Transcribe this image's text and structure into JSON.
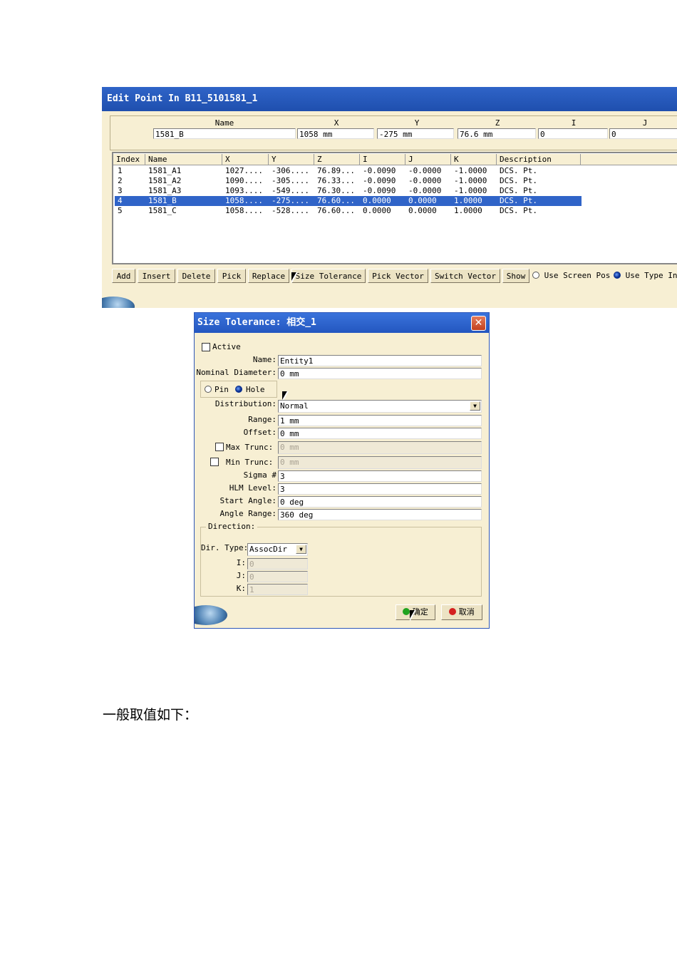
{
  "edit_point": {
    "title": "Edit Point In B11_5101581_1",
    "header_labels": [
      "Name",
      "X",
      "Y",
      "Z",
      "I",
      "J"
    ],
    "header_values": [
      "1581_B",
      "1058 mm",
      "-275 mm",
      "76.6 mm",
      "0",
      "0"
    ],
    "columns": [
      "Index",
      "Name",
      "X",
      "Y",
      "Z",
      "I",
      "J",
      "K",
      "Description"
    ],
    "rows": [
      [
        "1",
        "1581_A1",
        "1027....",
        "-306....",
        "76.89...",
        "-0.0090",
        "-0.0000",
        "-1.0000",
        "DCS. Pt."
      ],
      [
        "2",
        "1581_A2",
        "1090....",
        "-305....",
        "76.33...",
        "-0.0090",
        "-0.0000",
        "-1.0000",
        "DCS. Pt."
      ],
      [
        "3",
        "1581_A3",
        "1093....",
        "-549....",
        "76.30...",
        "-0.0090",
        "-0.0000",
        "-1.0000",
        "DCS. Pt."
      ],
      [
        "4",
        "1581_B",
        "1058....",
        "-275....",
        "76.60...",
        "0.0000",
        "0.0000",
        "1.0000",
        "DCS. Pt."
      ],
      [
        "5",
        "1581_C",
        "1058....",
        "-528....",
        "76.60...",
        "0.0000",
        "0.0000",
        "1.0000",
        "DCS. Pt."
      ]
    ],
    "selected_row_index": 3,
    "buttons": [
      "Add",
      "Insert",
      "Delete",
      "Pick",
      "Replace",
      "Size Tolerance",
      "Pick Vector",
      "Switch Vector",
      "Show"
    ],
    "radio_screen_pos": "Use Screen Pos",
    "radio_type_in": "Use Type In",
    "radio_selected": "Use Type In"
  },
  "size_tolerance": {
    "title": "Size Tolerance: 相交_1",
    "close": "✕",
    "active_label": "Active",
    "active_checked": false,
    "name_label": "Name:",
    "name_value": "Entity1",
    "nominal_label": "Nominal Diameter:",
    "nominal_value": "0 mm",
    "pin_label": "Pin",
    "hole_label": "Hole",
    "pin_hole_selected": "Hole",
    "distribution_label": "Distribution:",
    "distribution_value": "Normal",
    "range_label": "Range:",
    "range_value": "1 mm",
    "offset_label": "Offset:",
    "offset_value": "0 mm",
    "max_trunc_label": "Max Trunc:",
    "max_trunc_value": "0 mm",
    "min_trunc_label": "Min Trunc:",
    "min_trunc_value": "0 mm",
    "sigma_label": "Sigma #",
    "sigma_value": "3",
    "hlm_label": "HLM Level:",
    "hlm_value": "3",
    "start_angle_label": "Start Angle:",
    "start_angle_value": "0 deg",
    "angle_range_label": "Angle Range:",
    "angle_range_value": "360 deg",
    "direction_label": "Direction:",
    "dir_type_label": "Dir. Type:",
    "dir_type_value": "AssocDir",
    "i_label": "I:",
    "i_value": "0",
    "j_label": "J:",
    "j_value": "0",
    "k_label": "K:",
    "k_value": "1",
    "ok_label": "确定",
    "cancel_label": "取消",
    "ok_icon_color": "#1fa31f",
    "cancel_icon_color": "#d42020"
  },
  "footer_text": "一般取值如下："
}
